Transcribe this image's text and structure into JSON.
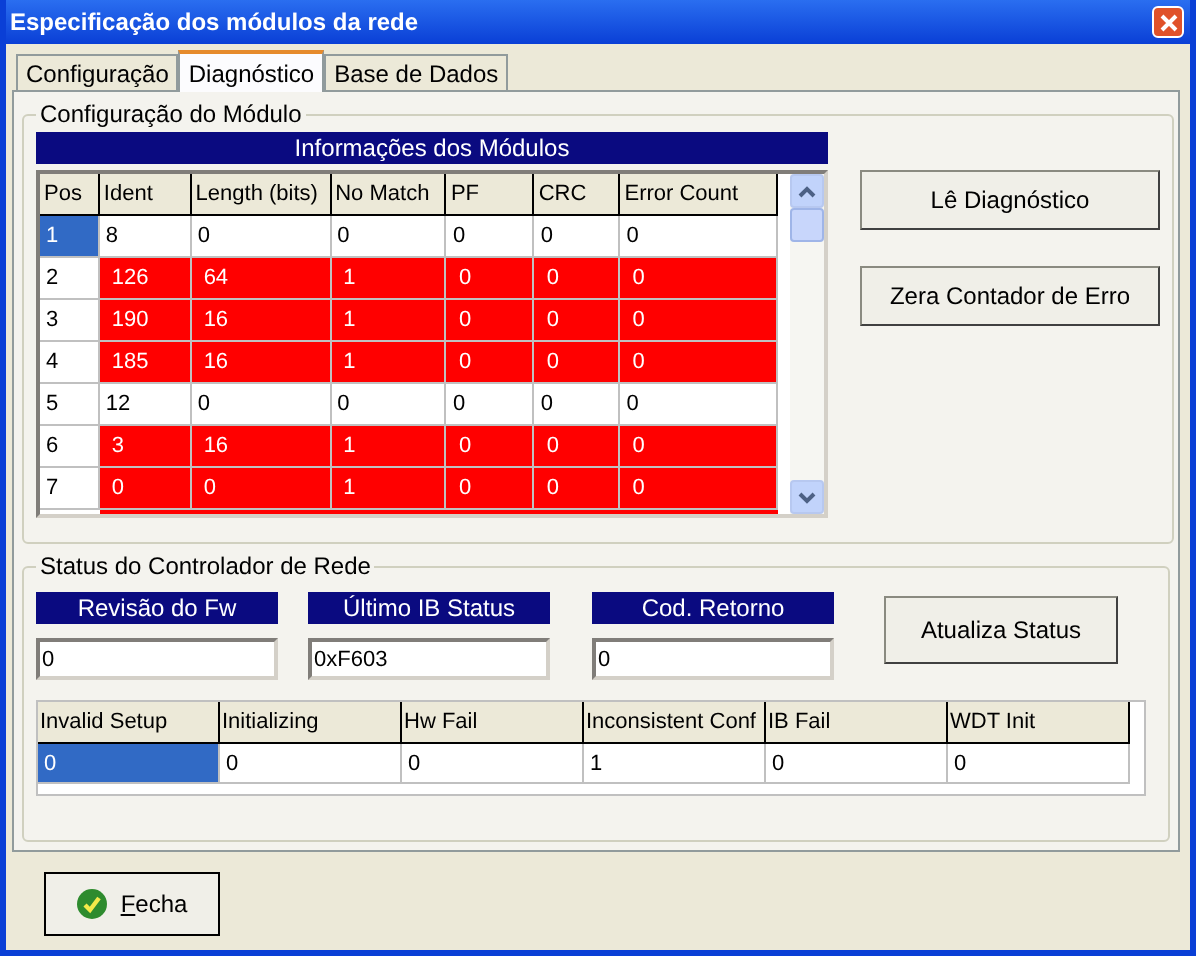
{
  "window": {
    "title": "Especificação dos módulos da rede"
  },
  "tabs": [
    {
      "label": "Configuração",
      "selected": false
    },
    {
      "label": "Diagnóstico",
      "selected": true
    },
    {
      "label": "Base de Dados",
      "selected": false
    }
  ],
  "module_group": {
    "title": "Configuração do Módulo",
    "table_title": "Informações dos Módulos",
    "columns": [
      "Pos",
      "Ident",
      "Length (bits)",
      "No Match",
      "PF",
      "CRC",
      "Error Count"
    ],
    "rows": [
      {
        "cells": [
          "1",
          "8",
          "0",
          "0",
          "0",
          "0",
          "0"
        ],
        "error": false,
        "selected": true
      },
      {
        "cells": [
          "2",
          "126",
          "64",
          "1",
          "0",
          "0",
          "0"
        ],
        "error": true,
        "selected": false
      },
      {
        "cells": [
          "3",
          "190",
          "16",
          "1",
          "0",
          "0",
          "0"
        ],
        "error": true,
        "selected": false
      },
      {
        "cells": [
          "4",
          "185",
          "16",
          "1",
          "0",
          "0",
          "0"
        ],
        "error": true,
        "selected": false
      },
      {
        "cells": [
          "5",
          "12",
          "0",
          "0",
          "0",
          "0",
          "0"
        ],
        "error": false,
        "selected": false
      },
      {
        "cells": [
          "6",
          "3",
          "16",
          "1",
          "0",
          "0",
          "0"
        ],
        "error": true,
        "selected": false
      },
      {
        "cells": [
          "7",
          "0",
          "0",
          "1",
          "0",
          "0",
          "0"
        ],
        "error": true,
        "selected": false
      }
    ],
    "buttons": [
      "Lê Diagnóstico",
      "Zera Contador de Erro"
    ]
  },
  "status_group": {
    "title": "Status do Controlador de Rede",
    "fields": [
      {
        "label": "Revisão do Fw",
        "value": "0"
      },
      {
        "label": "Último IB Status",
        "value": "0xF603"
      },
      {
        "label": "Cod. Retorno",
        "value": "0"
      }
    ],
    "button": "Atualiza Status",
    "columns": [
      "Invalid Setup",
      "Initializing",
      "Hw Fail",
      "Inconsistent Conf",
      "IB Fail",
      "WDT Init"
    ],
    "values": [
      {
        "text": "0",
        "selected": true
      },
      {
        "text": "0",
        "selected": false
      },
      {
        "text": "0",
        "selected": false
      },
      {
        "text": "1",
        "selected": false
      },
      {
        "text": "0",
        "selected": false
      },
      {
        "text": "0",
        "selected": false
      }
    ]
  },
  "close_button": {
    "label": "Fecha"
  }
}
